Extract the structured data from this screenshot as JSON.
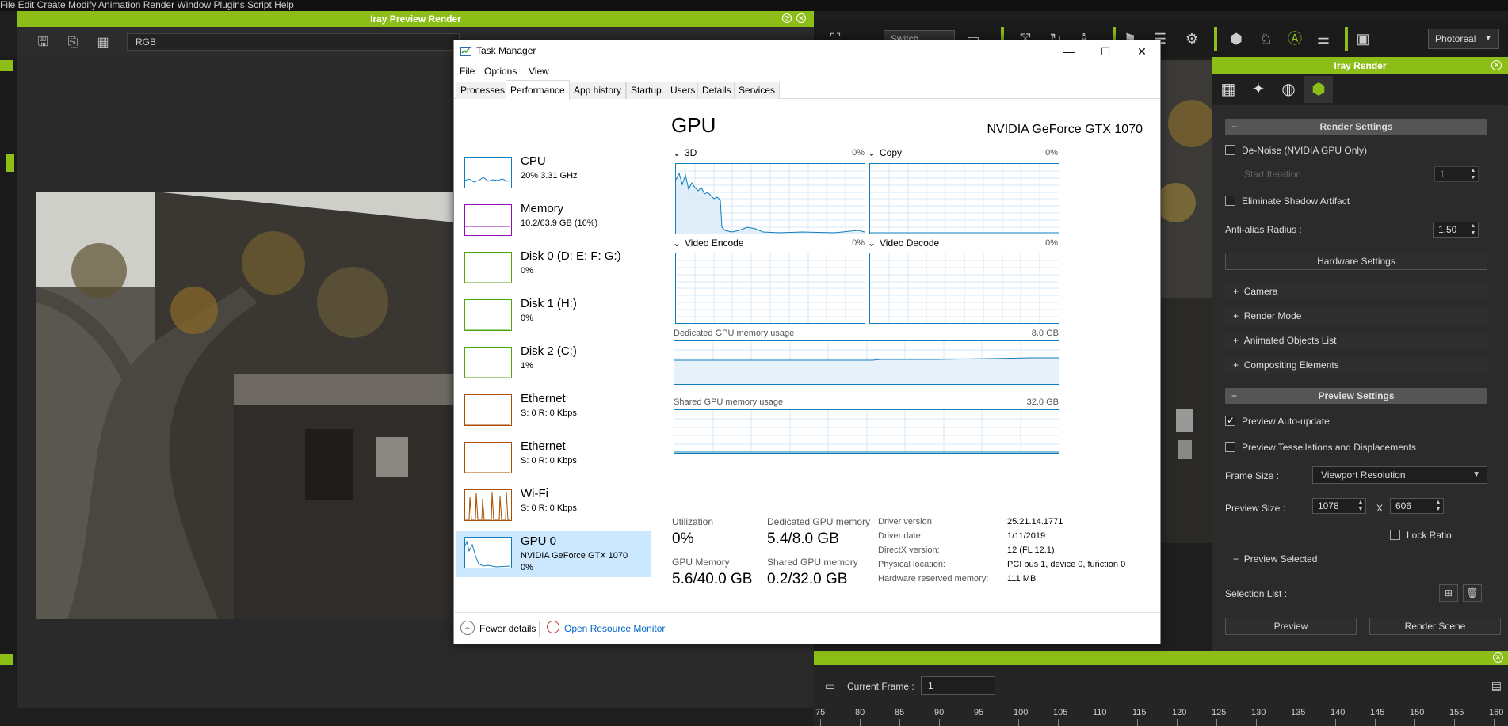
{
  "app": {
    "menubar_text": "File Edit Create Modify Animation Render Window Plugins Script Help",
    "preview_window": {
      "title": "Iray Preview Render",
      "channel": "RGB"
    },
    "toolbar": {
      "switch_label": "Switch",
      "render_mode": "Photoreal"
    }
  },
  "iray_panel": {
    "title": "Iray Render",
    "render_settings": {
      "header": "Render Settings",
      "denoise": {
        "label": "De-Noise (NVIDIA GPU Only)",
        "checked": false
      },
      "start_iteration": {
        "label": "Start Iteration",
        "value": "1"
      },
      "eliminate_shadow": {
        "label": "Eliminate Shadow Artifact",
        "checked": false
      },
      "anti_alias": {
        "label": "Anti-alias Radius :",
        "value": "1.50"
      },
      "hardware_button": "Hardware Settings",
      "sections": [
        "Camera",
        "Render Mode",
        "Animated Objects List",
        "Compositing Elements"
      ]
    },
    "preview_settings": {
      "header": "Preview Settings",
      "auto_update": {
        "label": "Preview Auto-update",
        "checked": true
      },
      "tessellations": {
        "label": "Preview Tessellations and Displacements",
        "checked": false
      },
      "frame_size": {
        "label": "Frame Size :",
        "value": "Viewport Resolution"
      },
      "preview_size": {
        "label": "Preview Size :",
        "width": "1078",
        "x": "X",
        "height": "606"
      },
      "lock_ratio": {
        "label": "Lock Ratio",
        "checked": false
      },
      "preview_selected": "Preview Selected",
      "selection_list": "Selection List :"
    },
    "buttons": {
      "preview": "Preview",
      "render_scene": "Render Scene"
    }
  },
  "timeline": {
    "current_frame_label": "Current Frame :",
    "current_frame": "1",
    "ruler": [
      "75",
      "80",
      "85",
      "90",
      "95",
      "100",
      "105",
      "110",
      "115",
      "120",
      "125",
      "130",
      "135",
      "140",
      "145",
      "150",
      "155",
      "160"
    ]
  },
  "task_manager": {
    "title": "Task Manager",
    "menu": [
      "File",
      "Options",
      "View"
    ],
    "tabs": [
      "Processes",
      "Performance",
      "App history",
      "Startup",
      "Users",
      "Details",
      "Services"
    ],
    "active_tab": "Performance",
    "sidebar": [
      {
        "name": "CPU",
        "sub1": "20% 3.31 GHz",
        "sub2": "",
        "color": "#117dbb"
      },
      {
        "name": "Memory",
        "sub1": "10.2/63.9 GB (16%)",
        "sub2": "",
        "color": "#8b12ae"
      },
      {
        "name": "Disk 0 (D: E: F: G:)",
        "sub1": "0%",
        "sub2": "",
        "color": "#4da60c"
      },
      {
        "name": "Disk 1 (H:)",
        "sub1": "0%",
        "sub2": "",
        "color": "#4da60c"
      },
      {
        "name": "Disk 2 (C:)",
        "sub1": "1%",
        "sub2": "",
        "color": "#4da60c"
      },
      {
        "name": "Ethernet",
        "sub1": "S: 0 R: 0 Kbps",
        "sub2": "",
        "color": "#a74f01"
      },
      {
        "name": "Ethernet",
        "sub1": "S: 0 R: 0 Kbps",
        "sub2": "",
        "color": "#a74f01"
      },
      {
        "name": "Wi-Fi",
        "sub1": "S: 0 R: 0 Kbps",
        "sub2": "",
        "color": "#a74f01"
      },
      {
        "name": "GPU 0",
        "sub1": "NVIDIA GeForce GTX 1070",
        "sub2": "0%",
        "color": "#117dbb"
      }
    ],
    "gpu": {
      "title": "GPU",
      "model": "NVIDIA GeForce GTX 1070",
      "engines": [
        {
          "name": "3D",
          "pct": "0%"
        },
        {
          "name": "Copy",
          "pct": "0%"
        },
        {
          "name": "Video Encode",
          "pct": "0%"
        },
        {
          "name": "Video Decode",
          "pct": "0%"
        }
      ],
      "dedicated_label": "Dedicated GPU memory usage",
      "dedicated_max": "8.0 GB",
      "shared_label": "Shared GPU memory usage",
      "shared_max": "32.0 GB",
      "stats": {
        "utilization_label": "Utilization",
        "utilization": "0%",
        "dedicated_mem_label": "Dedicated GPU memory",
        "dedicated_mem": "5.4/8.0 GB",
        "gpu_memory_label": "GPU Memory",
        "gpu_memory": "5.6/40.0 GB",
        "shared_mem_label": "Shared GPU memory",
        "shared_mem": "0.2/32.0 GB"
      },
      "details": [
        {
          "key": "Driver version:",
          "value": "25.21.14.1771"
        },
        {
          "key": "Driver date:",
          "value": "1/11/2019"
        },
        {
          "key": "DirectX version:",
          "value": "12 (FL 12.1)"
        },
        {
          "key": "Physical location:",
          "value": "PCI bus 1, device 0, function 0"
        },
        {
          "key": "Hardware reserved memory:",
          "value": "111 MB"
        }
      ]
    },
    "footer": {
      "fewer_details": "Fewer details",
      "resource_monitor": "Open Resource Monitor"
    }
  }
}
